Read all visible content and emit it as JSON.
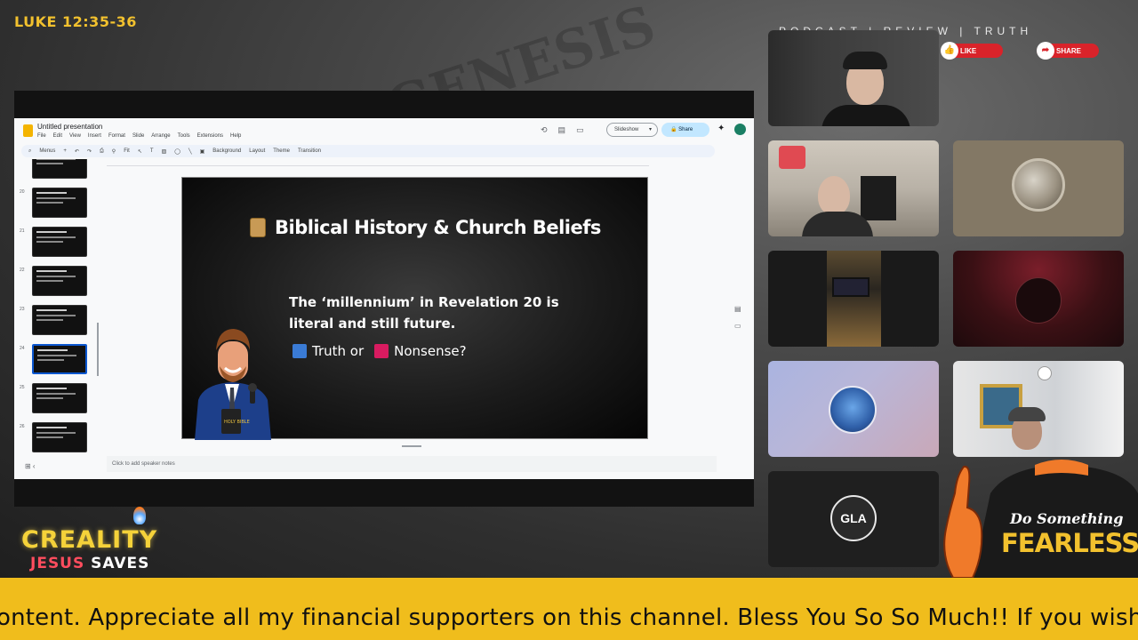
{
  "overlay": {
    "scripture_ref": "LUKE 12:35-36",
    "top_tagline": "PODCAST | REVIEW | TRUTH",
    "like_label": "LIKE",
    "share_label": "SHARE",
    "brand_line1": "CREALITY",
    "brand_jesus": "JESUS",
    "brand_saves": "SAVES",
    "shirt_line1": "Do Something",
    "shirt_line2": "FEARLESS",
    "ticker": "ontent.   Appreciate all my financial supporters on this channel. Bless You So So Much!! If you wish t"
  },
  "slides_app": {
    "doc_title": "Untitled presentation",
    "menu": [
      "File",
      "Edit",
      "View",
      "Insert",
      "Format",
      "Slide",
      "Arrange",
      "Tools",
      "Extensions",
      "Help"
    ],
    "toolbar": [
      "Menus",
      "Fit",
      "Background",
      "Layout",
      "Theme",
      "Transition"
    ],
    "slideshow_label": "Slideshow",
    "share_label": "Share",
    "notes_placeholder": "Click to add speaker notes",
    "filmstrip_numbers": [
      "",
      "20",
      "21",
      "22",
      "23",
      "24",
      "25",
      "26"
    ],
    "selected_slide": "24"
  },
  "slide": {
    "title": "Biblical History & Church Beliefs",
    "statement": "The ‘millennium’ in Revelation 20 is literal and still future.",
    "choice_truth": "Truth or",
    "choice_nonsense": "Nonsense?",
    "bible_label": "HOLY BIBLE"
  },
  "participants": {
    "gla_initials": "GLA"
  },
  "colors": {
    "accent_yellow": "#f0bd1c",
    "brand_yellow": "#f5d23a",
    "jesus_red": "#ff4d5e",
    "pill_red": "#d9232a",
    "truth_blue": "#3a7bd5",
    "nonsense_pink": "#d81b60"
  }
}
